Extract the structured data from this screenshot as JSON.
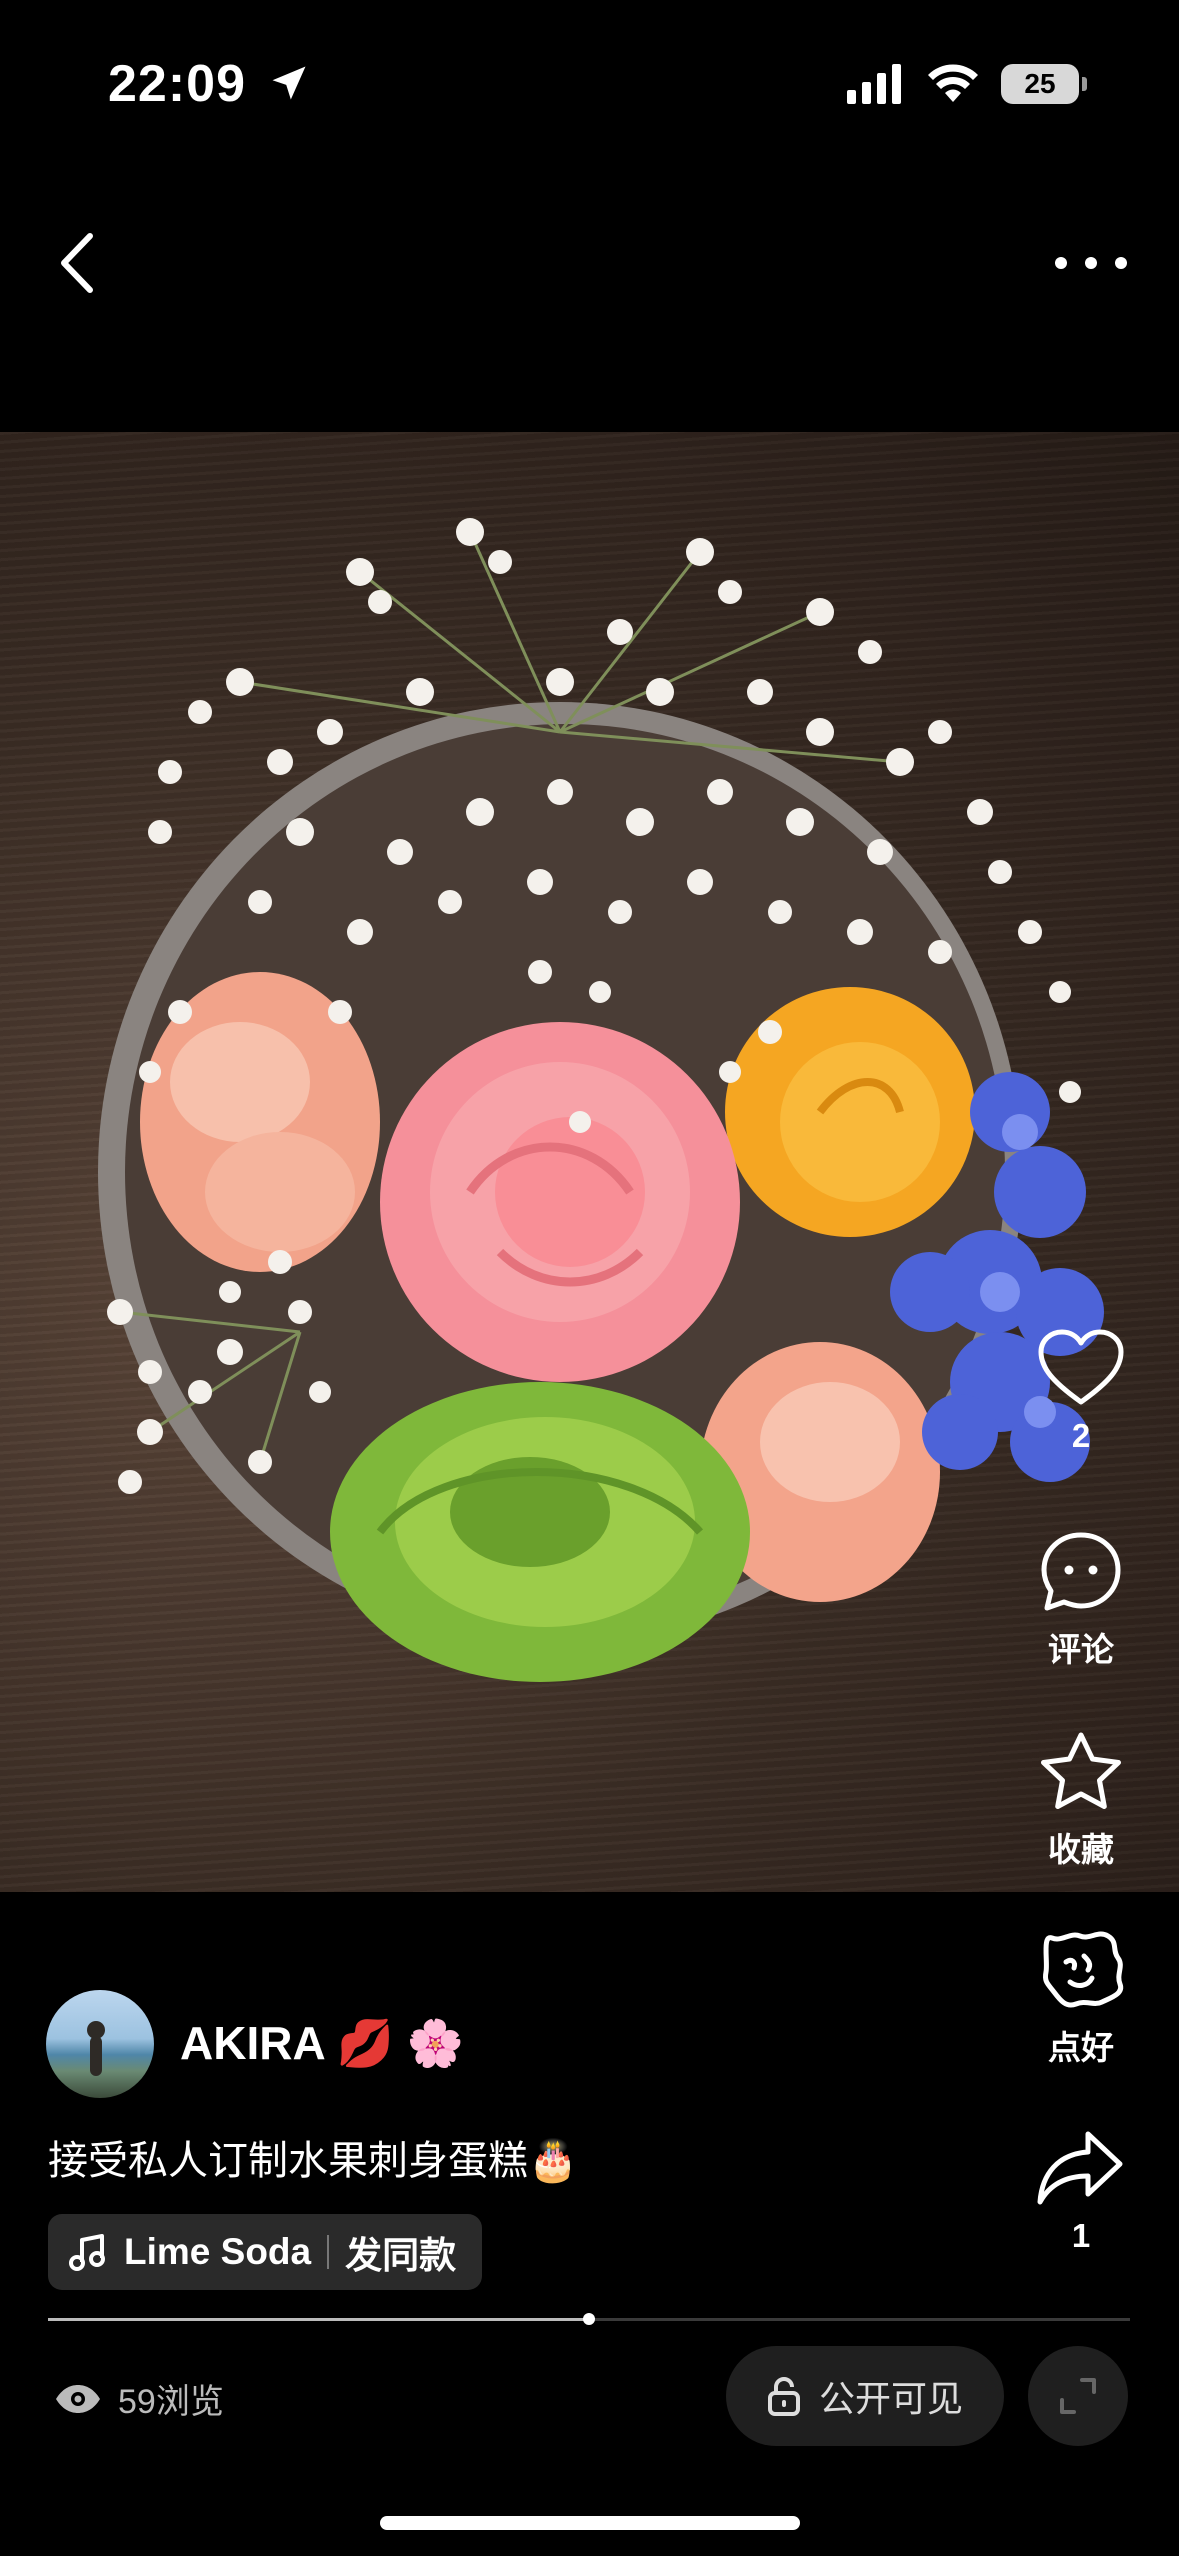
{
  "status_bar": {
    "time": "22:09",
    "battery": "25"
  },
  "nav": {
    "back_icon": "chevron-left-icon",
    "more_icon": "ellipsis-icon"
  },
  "actions": {
    "like_count": "2",
    "comment_label": "评论",
    "favorite_label": "收藏",
    "nice_label": "点好",
    "share_count": "1"
  },
  "post": {
    "username": "AKIRA",
    "username_emoji": "💋 🌸",
    "caption": "接受私人订制水果刺身蛋糕",
    "caption_emoji": "🎂",
    "music_title": "Lime Soda",
    "music_action": "发同款",
    "progress": 0.5,
    "views": "59浏览",
    "visibility": "公开可见"
  },
  "colors": {
    "accent_pink": "#f5a0a6",
    "background": "#000000"
  }
}
